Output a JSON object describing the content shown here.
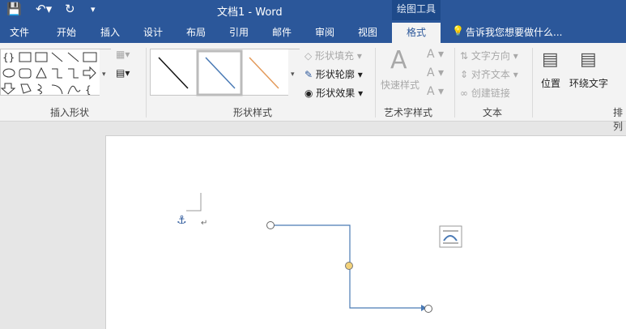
{
  "titlebar": {
    "title": "文档1 - Word",
    "context_tab_group": "绘图工具",
    "save_icon": "save-icon",
    "undo_icon": "undo-icon",
    "redo_icon": "redo-icon",
    "customize_icon": "customize-qat-icon"
  },
  "tabs": [
    "文件",
    "开始",
    "插入",
    "设计",
    "布局",
    "引用",
    "邮件",
    "审阅",
    "视图",
    "格式"
  ],
  "active_tab": "格式",
  "tell_me": "告诉我您想要做什么...",
  "groups": {
    "insert_shapes": {
      "label": "插入形状"
    },
    "shape_styles": {
      "label": "形状样式",
      "fill": "形状填充",
      "outline": "形状轮廓",
      "effects": "形状效果"
    },
    "wordart": {
      "label": "艺术字样式",
      "quick_styles": "快速样式"
    },
    "text": {
      "label": "文本",
      "direction": "文字方向",
      "align": "对齐文本",
      "link": "创建链接"
    },
    "arrange": {
      "label": "排列",
      "position": "位置",
      "wrap": "环绕文字"
    }
  },
  "colors": {
    "brand": "#2b579a",
    "connector": "#4a7ab5",
    "handle_mid": "#f3d27a"
  }
}
